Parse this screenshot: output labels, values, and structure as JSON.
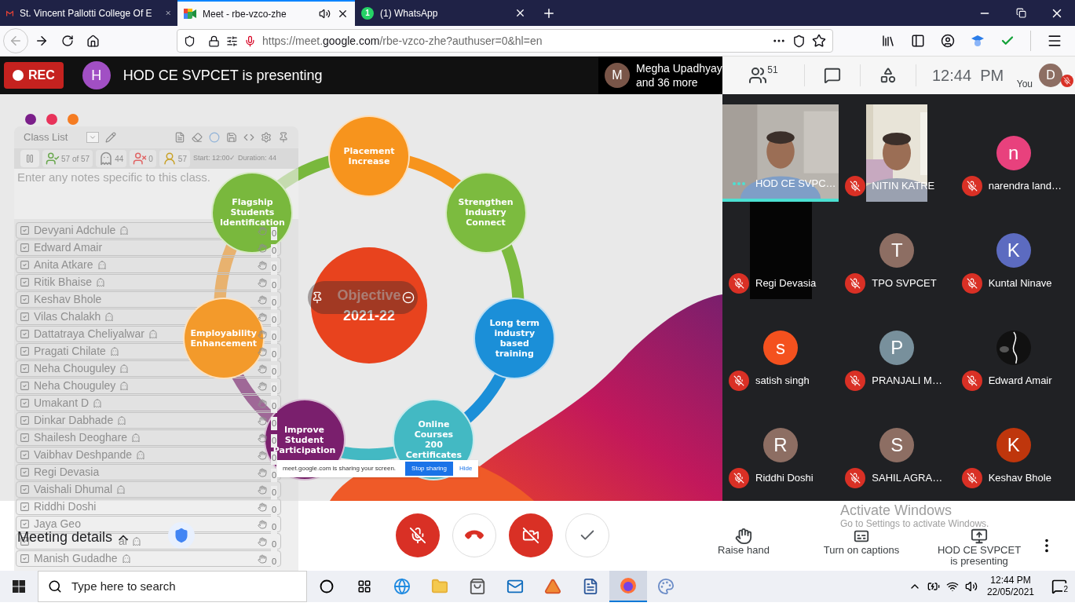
{
  "browser": {
    "tabs": [
      {
        "kind": "gmail",
        "title": "St. Vincent Pallotti College Of E",
        "selected": false,
        "audio": false
      },
      {
        "kind": "meet",
        "title": "Meet - rbe-vzco-zhe",
        "selected": true,
        "audio": true
      },
      {
        "kind": "whatsapp",
        "title": "(1) WhatsApp",
        "badge": "1",
        "selected": false,
        "audio": false
      }
    ],
    "url": "https://meet.**google.com**/rbe-vzco-zhe?authuser=0&hl=en"
  },
  "meet_bar": {
    "recording": {
      "label": "REC",
      "on": true
    },
    "presenter": {
      "initial": "H",
      "color": "#a14fc4",
      "text": "HOD CE SVPCET is presenting"
    },
    "joined": {
      "initial": "M",
      "color": "#795548",
      "line1": "Megha Upadhyay",
      "line2": "and 36 more"
    },
    "people_count": "51",
    "time": "12:44  PM",
    "self": {
      "label": "You",
      "initial": "D",
      "color": "#8d6e63",
      "muted": true
    }
  },
  "slide": {
    "dots": [
      {
        "color": "#7b1f8a"
      },
      {
        "color": "#e8335a"
      },
      {
        "color": "#f57c22"
      }
    ],
    "center": {
      "line1": "Objective",
      "line2": "2021-22"
    },
    "steps": [
      {
        "label": "Placement Increase",
        "color": "#f7941d"
      },
      {
        "label": "Flagship Students Identification",
        "color": "#79b83d"
      },
      {
        "label": "Strengthen Industry Connect",
        "color": "#7cbb3f"
      },
      {
        "label": "Employability Enhancement",
        "color": "#f39a2b"
      },
      {
        "label": "Long term industry based training",
        "color": "#1b8fd8"
      },
      {
        "label": "Improve Student Participation",
        "color": "#7a1f6d"
      },
      {
        "label": "Online Courses 200 Certificates",
        "color": "#43b9c3"
      }
    ],
    "sharing_bar": {
      "text": "meet.google.com is sharing your screen.",
      "stop": "Stop sharing",
      "hide": "Hide"
    }
  },
  "class_list": {
    "title": "Class List",
    "stats": [
      {
        "kind": "present",
        "text": "57 of 57"
      },
      {
        "kind": "ghost",
        "text": "44"
      },
      {
        "kind": "absent",
        "text": "0"
      },
      {
        "kind": "unknown",
        "text": "57"
      }
    ],
    "timing": "Start: 12:00✓ Duration: 44",
    "notes_placeholder": "Enter any notes specific to this class.",
    "rows": [
      {
        "name": "Devyani Adchule",
        "ghost": true,
        "checked": true,
        "count": "0"
      },
      {
        "name": "Edward Amair",
        "ghost": false,
        "checked": true,
        "count": "0"
      },
      {
        "name": "Anita Atkare",
        "ghost": true,
        "checked": true,
        "count": "0"
      },
      {
        "name": "Ritik Bhaise",
        "ghost": true,
        "checked": true,
        "count": "0"
      },
      {
        "name": "Keshav Bhole",
        "ghost": false,
        "checked": true,
        "count": "0"
      },
      {
        "name": "Vilas Chalakh",
        "ghost": true,
        "checked": true,
        "count": "0"
      },
      {
        "name": "Dattatraya Cheliyalwar",
        "ghost": true,
        "checked": true,
        "count": "0"
      },
      {
        "name": "Pragati Chilate",
        "ghost": true,
        "checked": true,
        "count": "0"
      },
      {
        "name": "Neha Chouguley",
        "ghost": true,
        "checked": true,
        "count": "0"
      },
      {
        "name": "Neha Chouguley",
        "ghost": true,
        "checked": true,
        "count": "0"
      },
      {
        "name": "Umakant D",
        "ghost": true,
        "checked": true,
        "count": "0"
      },
      {
        "name": "Dinkar Dabhade",
        "ghost": true,
        "checked": true,
        "count": "0"
      },
      {
        "name": "Shailesh Deoghare",
        "ghost": true,
        "checked": true,
        "count": "0"
      },
      {
        "name": "Vaibhav Deshpande",
        "ghost": true,
        "checked": true,
        "count": "0"
      },
      {
        "name": "Regi Devasia",
        "ghost": false,
        "checked": true,
        "count": "0"
      },
      {
        "name": "Vaishali Dhumal",
        "ghost": true,
        "checked": true,
        "count": "0"
      },
      {
        "name": "Riddhi Doshi",
        "ghost": false,
        "checked": true,
        "count": "0"
      },
      {
        "name": "Jaya Geo",
        "ghost": false,
        "checked": true,
        "count": "0"
      },
      {
        "name": "ar",
        "covered": true,
        "ghost": true,
        "checked": true,
        "count": "0"
      },
      {
        "name": "Manish Gudadhe",
        "ghost": true,
        "checked": true,
        "count": "0"
      }
    ]
  },
  "tiles": [
    {
      "kind": "video",
      "name": "HOD CE SVPC…",
      "muted": false,
      "speaking": true
    },
    {
      "kind": "video-narrow",
      "name": "NITIN KATRE",
      "muted": true,
      "speaking": false
    },
    {
      "kind": "avatar",
      "initial": "n",
      "color": "#e8417d",
      "name": "narendra land…",
      "muted": true,
      "speaking": false
    },
    {
      "kind": "dark",
      "name": "Regi Devasia",
      "muted": true,
      "speaking": false
    },
    {
      "kind": "avatar",
      "initial": "T",
      "color": "#8d6e63",
      "name": "TPO SVPCET",
      "muted": true,
      "speaking": false
    },
    {
      "kind": "avatar",
      "initial": "K",
      "color": "#5c6bc0",
      "name": "Kuntal Ninave",
      "muted": true,
      "speaking": false
    },
    {
      "kind": "avatar",
      "initial": "s",
      "color": "#f4511e",
      "name": "satish singh",
      "muted": true,
      "speaking": false
    },
    {
      "kind": "avatar",
      "initial": "P",
      "color": "#78909c",
      "name": "PRANJALI M…",
      "muted": true,
      "speaking": false
    },
    {
      "kind": "image-avatar",
      "name": "Edward Amair",
      "muted": true,
      "speaking": false
    },
    {
      "kind": "avatar",
      "initial": "R",
      "color": "#8d6e63",
      "name": "Riddhi Doshi",
      "muted": true,
      "speaking": false
    },
    {
      "kind": "avatar",
      "initial": "S",
      "color": "#8d6e63",
      "name": "SAHIL AGRA…",
      "muted": true,
      "speaking": false
    },
    {
      "kind": "avatar",
      "initial": "K",
      "color": "#bf360c",
      "name": "Keshav Bhole",
      "muted": true,
      "speaking": false
    }
  ],
  "bottom_bar": {
    "meeting_details": "Meeting details",
    "controls": [
      {
        "kind": "mic",
        "on": false
      },
      {
        "kind": "hangup"
      },
      {
        "kind": "camera",
        "on": false
      },
      {
        "kind": "check"
      }
    ],
    "actions": [
      {
        "kind": "hand",
        "label": "Raise hand"
      },
      {
        "kind": "captions",
        "label": "Turn on captions"
      },
      {
        "kind": "present",
        "label": "HOD CE SVPCET is presenting"
      }
    ],
    "activate": {
      "title": "Activate Windows",
      "subtitle": "Go to Settings to activate Windows."
    }
  },
  "taskbar": {
    "search_placeholder": "Type here to search",
    "apps": [
      {
        "kind": "cortana",
        "active": false
      },
      {
        "kind": "taskview",
        "active": false
      },
      {
        "kind": "edge",
        "active": false
      },
      {
        "kind": "folder",
        "active": false
      },
      {
        "kind": "store",
        "active": false
      },
      {
        "kind": "mail",
        "active": false
      },
      {
        "kind": "matlab",
        "active": false
      },
      {
        "kind": "word",
        "active": false
      },
      {
        "kind": "firefox",
        "active": true
      },
      {
        "kind": "paint",
        "active": false
      }
    ],
    "time": "12:44 PM",
    "date": "22/05/2021",
    "notifications": "2"
  }
}
